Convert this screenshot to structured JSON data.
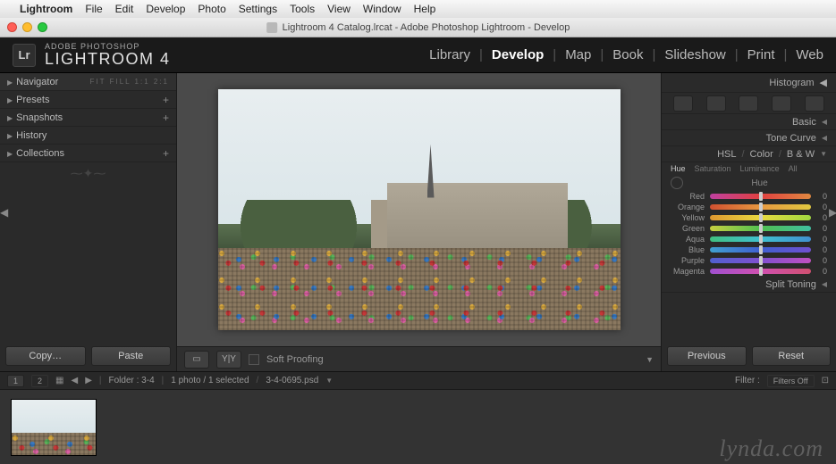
{
  "mac_menu": {
    "apple": "",
    "app": "Lightroom",
    "items": [
      "File",
      "Edit",
      "Develop",
      "Photo",
      "Settings",
      "Tools",
      "View",
      "Window",
      "Help"
    ]
  },
  "window": {
    "title": "Lightroom 4 Catalog.lrcat - Adobe Photoshop Lightroom - Develop"
  },
  "branding": {
    "logo": "Lr",
    "line1": "ADOBE PHOTOSHOP",
    "line2": "LIGHTROOM 4"
  },
  "modules": {
    "items": [
      "Library",
      "Develop",
      "Map",
      "Book",
      "Slideshow",
      "Print",
      "Web"
    ],
    "active": "Develop"
  },
  "left_panel": {
    "navigator": {
      "label": "Navigator",
      "sub": "FIT  FILL  1:1  2:1"
    },
    "presets": "Presets",
    "snapshots": "Snapshots",
    "history": "History",
    "collections": "Collections",
    "copy": "Copy…",
    "paste": "Paste"
  },
  "center_toolbar": {
    "soft_proofing": "Soft Proofing"
  },
  "right_panel": {
    "histogram": "Histogram",
    "basic": "Basic",
    "tone_curve": "Tone Curve",
    "hsl_header": {
      "hsl": "HSL",
      "color": "Color",
      "bw": "B & W"
    },
    "hsl_tabs": {
      "hue": "Hue",
      "saturation": "Saturation",
      "luminance": "Luminance",
      "all": "All",
      "active": "Hue"
    },
    "hue_label": "Hue",
    "sliders": [
      {
        "name": "Red",
        "value": 0,
        "grad": "g-red"
      },
      {
        "name": "Orange",
        "value": 0,
        "grad": "g-orange"
      },
      {
        "name": "Yellow",
        "value": 0,
        "grad": "g-yellow"
      },
      {
        "name": "Green",
        "value": 0,
        "grad": "g-green"
      },
      {
        "name": "Aqua",
        "value": 0,
        "grad": "g-aqua"
      },
      {
        "name": "Blue",
        "value": 0,
        "grad": "g-blue"
      },
      {
        "name": "Purple",
        "value": 0,
        "grad": "g-purple"
      },
      {
        "name": "Magenta",
        "value": 0,
        "grad": "g-magenta"
      }
    ],
    "split_toning": "Split Toning",
    "previous": "Previous",
    "reset": "Reset"
  },
  "info_bar": {
    "seg_a": "1",
    "seg_b": "2",
    "folder_label": "Folder : 3-4",
    "count": "1 photo / 1 selected",
    "filename": "3-4-0695.psd",
    "filter_label": "Filter :",
    "filter_value": "Filters Off"
  },
  "watermark": "lynda.com"
}
